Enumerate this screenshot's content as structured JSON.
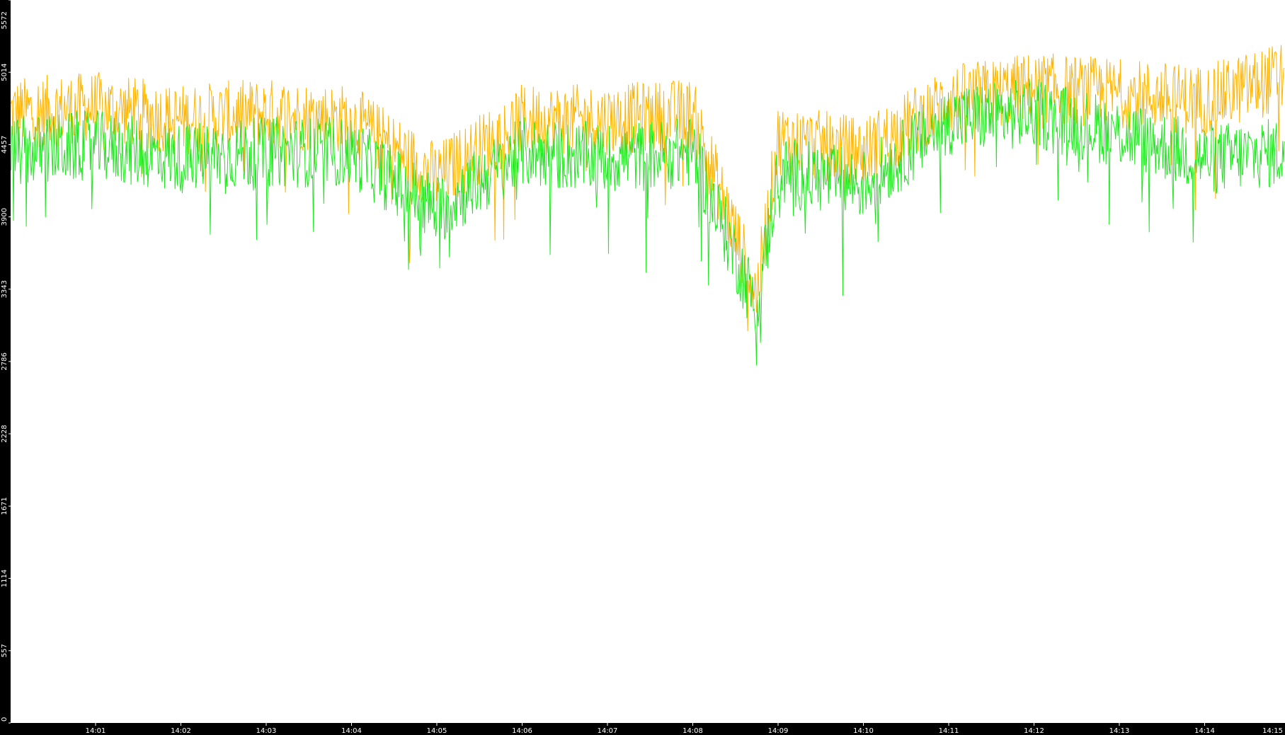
{
  "chart_data": {
    "type": "line",
    "title": "",
    "xlabel": "",
    "ylabel": "",
    "ylim": [
      0,
      5572
    ],
    "yticks": [
      "0",
      "557",
      "1114",
      "1671",
      "2228",
      "2786",
      "3343",
      "3900",
      "4457",
      "5014",
      "5572"
    ],
    "xticks": [
      "14:01",
      "14:02",
      "14:03",
      "14:04",
      "14:05",
      "14:06",
      "14:07",
      "14:08",
      "14:09",
      "14:10",
      "14:11",
      "14:12",
      "14:13",
      "14:14",
      "14:15"
    ],
    "x_range_minutes": [
      "14:00",
      "14:15"
    ],
    "grid": false,
    "legend": "none",
    "series": [
      {
        "color": "#ffb400",
        "approx_level_by_minute": [
          {
            "t": "14:00",
            "y": 4700
          },
          {
            "t": "14:01",
            "y": 4750
          },
          {
            "t": "14:02",
            "y": 4650
          },
          {
            "t": "14:03",
            "y": 4700
          },
          {
            "t": "14:04",
            "y": 4650
          },
          {
            "t": "14:05",
            "y": 4200
          },
          {
            "t": "14:06",
            "y": 4650
          },
          {
            "t": "14:07",
            "y": 4650
          },
          {
            "t": "14:08",
            "y": 4700
          },
          {
            "t": "14:08:45",
            "y": 3300
          },
          {
            "t": "14:09",
            "y": 4500
          },
          {
            "t": "14:10",
            "y": 4400
          },
          {
            "t": "14:11",
            "y": 4800
          },
          {
            "t": "14:12",
            "y": 4900
          },
          {
            "t": "14:13",
            "y": 4850
          },
          {
            "t": "14:14",
            "y": 4800
          },
          {
            "t": "14:15",
            "y": 5000
          }
        ]
      },
      {
        "color": "#22e622",
        "approx_level_by_minute": [
          {
            "t": "14:00",
            "y": 4400
          },
          {
            "t": "14:01",
            "y": 4450
          },
          {
            "t": "14:02",
            "y": 4350
          },
          {
            "t": "14:03",
            "y": 4400
          },
          {
            "t": "14:04",
            "y": 4400
          },
          {
            "t": "14:05",
            "y": 3950
          },
          {
            "t": "14:06",
            "y": 4400
          },
          {
            "t": "14:07",
            "y": 4350
          },
          {
            "t": "14:08",
            "y": 4400
          },
          {
            "t": "14:08:45",
            "y": 3200
          },
          {
            "t": "14:09",
            "y": 4250
          },
          {
            "t": "14:10",
            "y": 4150
          },
          {
            "t": "14:11",
            "y": 4650
          },
          {
            "t": "14:12",
            "y": 4700
          },
          {
            "t": "14:13",
            "y": 4550
          },
          {
            "t": "14:14",
            "y": 4350
          },
          {
            "t": "14:15",
            "y": 4400
          }
        ]
      }
    ]
  }
}
